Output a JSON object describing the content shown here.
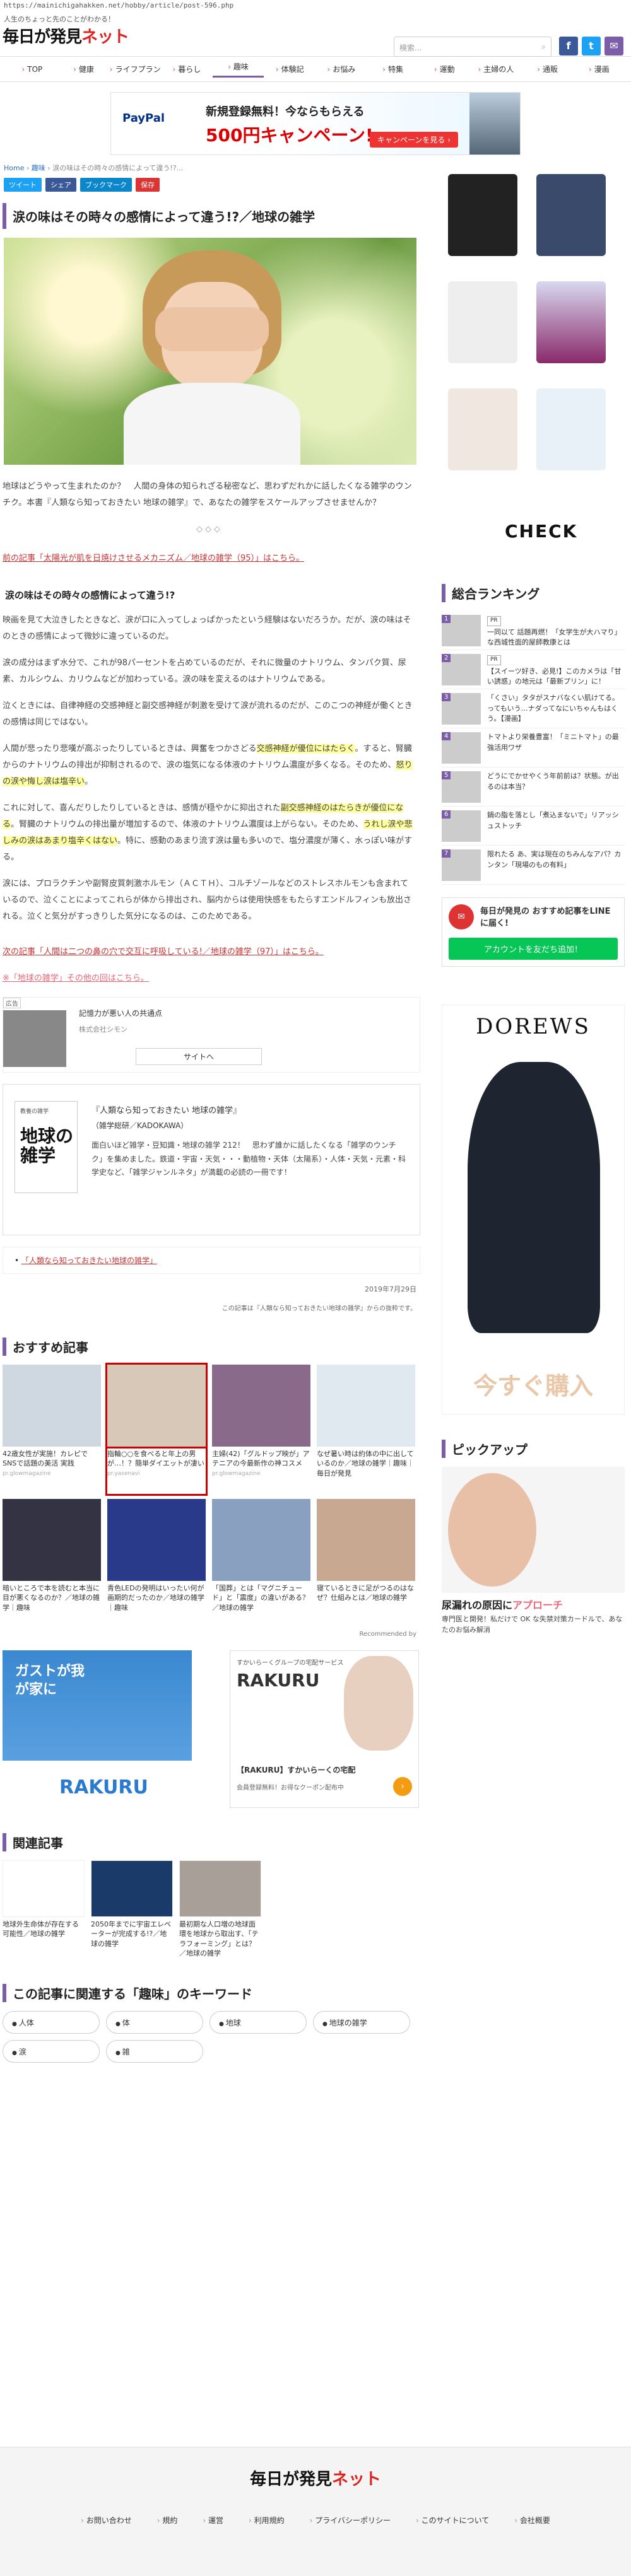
{
  "url": "https://mainichigahakken.net/hobby/article/post-596.php",
  "header": {
    "tagline": "人生のちょっと先のことがわかる！",
    "logo": "毎日が発見ネット",
    "search_placeholder": "検索...",
    "search_icon": "search-icon",
    "sns": [
      {
        "name": "facebook",
        "label": "f",
        "color": "#3b5998"
      },
      {
        "name": "twitter",
        "label": "t",
        "color": "#1da1f2"
      },
      {
        "name": "mail",
        "label": "✉",
        "color": "#7b5ea7"
      }
    ]
  },
  "nav": [
    "TOP",
    "健康",
    "ライフプラン",
    "暮らし",
    "趣味",
    "体験記",
    "お悩み",
    "特集",
    "運動",
    "主婦の人",
    "通販",
    "漫画"
  ],
  "nav_active": 4,
  "top_ad": {
    "brand": "PayPal",
    "line1": "新規登録無料！今ならもらえる",
    "line2": "500円キャンペーン!",
    "button": "キャンペーンを見る ›"
  },
  "breadcrumb": {
    "home": "Home",
    "cat": "趣味",
    "current": "涙の味はその時々の感情によって違う!?..."
  },
  "share": [
    {
      "label": "ツイート",
      "color": "#1da1f2"
    },
    {
      "label": "シェア",
      "color": "#3b5998"
    },
    {
      "label": "ブックマーク",
      "color": "#0a87cb"
    },
    {
      "label": "保存",
      "color": "#d33"
    }
  ],
  "article": {
    "title": "涙の味はその時々の感情によって違う!?／地球の雑学",
    "intro": "地球はどうやって生まれたのか？　人間の身体の知られざる秘密など、思わずだれかに話したくなる雑学のウンチク。本書『人類なら知っておきたい 地球の雑学』で、あなたの雑学をスケールアップさせませんか？",
    "dots": "◇◇◇",
    "prev_link": "前の記事「太陽光が肌を日焼けさせるメカニズム／地球の雑学（95）」はこちら。",
    "section_title": "涙の味はその時々の感情によって違う!?",
    "p1": "映画を見て大泣きしたときなど、涙が口に入ってしょっぱかったという経験はないだろうか。だが、涙の味はそのときの感情によって微妙に違っているのだ。",
    "p2": "涙の成分はまず水分で、これが98パーセントを占めているのだが、それに微量のナトリウム、タンパク質、尿素、カルシウム、カリウムなどが加わっている。涙の味を変えるのはナトリウムである。",
    "p3": "泣くときには、自律神経の交感神経と副交感神経が刺激を受けて涙が流れるのだが、このこつの神経が働くときの感情は同じではない。",
    "p4_a": "人間が悲ったり悲嘆が高ぶったりしているときは、興奮をつかさどる",
    "p4_hl1": "交感神経が優位にはたらく",
    "p4_b": "。すると、腎臓からのナトリウムの排出が抑制されるので、涙の塩気になる体液のナトリウム濃度が多くなる。そのため、",
    "p4_hl2": "怒りの涙や悔し涙は塩辛い",
    "p4_c": "。",
    "p5_a": "これに対して、喜んだりしたりしているときは、感情が穏やかに抑出された",
    "p5_hl1": "副交感神経のはたらきが優位になる",
    "p5_b": "。腎臓のナトリウムの排出量が増加するので、体液のナトリウム濃度は上がらない。そのため、",
    "p5_hl2": "うれし涙や悲しみの涙はあまり塩辛くはない",
    "p5_c": "。特に、感動のあまり流す涙は量も多いので、塩分濃度が薄く、水っぽい味がする。",
    "p6": "涙には、プロラクチンや副腎皮質刺激ホルモン（ＡＣＴＨ）、コルチゾールなどのストレスホルモンも含まれているので、泣くことによってこれらが体から排出され、脳内からは使用快感をもたらすエンドルフィンも放出される。泣くと気分がすっきりした気分になるのは、このためである。",
    "next_link": "次の記事「人間は二つの鼻の穴で交互に呼吸している!／地球の雑学（97）」はこちら。",
    "list_link": "※「地球の雑学」その他の回はこちら。"
  },
  "inline_ad": {
    "tag": "広告",
    "title": "記憶力が悪い人の共通点",
    "sponsor": "株式会社シモン",
    "button": "サイトへ"
  },
  "book": {
    "cover_small": "教養の雑学",
    "cover_title": "地球の雑学",
    "title": "『人類なら知っておきたい 地球の雑学』",
    "publisher": "（雑学総研／KADOKAWA）",
    "desc": "面白いほど雑学・豆知識・地球の雑学 212！　思わず誰かに話したくなる「雑学のウンチク」を集めました。鉄道・宇宙・天気・・・動植物・天体（太陽系）・人体・天気・元素・科学史など、「雑学ジャンルネタ」が満載の必読の一冊です！"
  },
  "link_box": "「人類なら知っておきたい地球の雑学」",
  "date": "2019年7月29日",
  "credit": "この記事は『人類なら知っておきたい地球の雑学』からの抜粋です。",
  "reco": {
    "heading": "おすすめ記事",
    "items": [
      {
        "cap": "42歳女性が実施！カレピで SNSで話題の美活 実践",
        "src": "pr.glowmagazine",
        "color": "#cfd8e0"
      },
      {
        "cap": "指輪○○を食べると年上の男が…！？簡単ダイエットが凄い",
        "src": "pr.yasenavi",
        "color": "#d8c8b8",
        "selected": true
      },
      {
        "cap": "主婦(42)「グルドップ映が」アテニアの今最新作の神コスメ",
        "src": "pr.glowmagazine",
        "color": "#8a6a8a"
      },
      {
        "cap": "なぜ暑い時は約体の中に出しているのか／地球の雑学｜趣味｜毎日が発見",
        "src": "",
        "color": "#e0e8f0"
      },
      {
        "cap": "暗いところで本を読むと本当に目が悪くなるのか？／地球の雑学｜趣味",
        "src": "",
        "color": "#334"
      },
      {
        "cap": "青色LEDの発明はいったい何が画期的だったのか／地球の雑学｜趣味",
        "src": "",
        "color": "#2a3a8a"
      },
      {
        "cap": "「国葬」とは「マグニチュード」と「震度」の違いがある？／地球の雑学",
        "src": "",
        "color": "#8aa0c0"
      },
      {
        "cap": "寝ているときに足がつるのはなぜ？仕組みとは／地球の雑学",
        "src": "",
        "color": "#c8a890"
      }
    ],
    "recommended_by": "Recommended by"
  },
  "bottom_ads": {
    "gusto": {
      "l1": "ガストが我が家に",
      "l2": "RAKURU"
    },
    "rakuru": {
      "l1": "すかいらーくグループの宅配サービス",
      "l2": "RAKURU",
      "l3": "【RAKURU】すかいらーくの宅配",
      "l4": "会員登録無料！お得なクーポン配布中"
    }
  },
  "related": {
    "heading": "関連記事",
    "items": [
      {
        "cap": "地球外生命体が存在する可能性／地球の雑学",
        "color": "#fff"
      },
      {
        "cap": "2050年までに宇宙エレベーターが完成する!?／地球の雑学",
        "color": "#1a3a6a"
      },
      {
        "cap": "最初期な人口増の地球面環を地球から取出す、「テラフォーミング」とは？／地球の雑学",
        "color": "#a8a098"
      }
    ]
  },
  "keywords": {
    "heading": "この記事に関連する「趣味」のキーワード",
    "items": [
      "人体",
      "体",
      "地球",
      "地球の雑学",
      "涙",
      "雑"
    ]
  },
  "side": {
    "ranking_heading": "総合ランキング",
    "ranking": [
      {
        "pr": true,
        "text": "一同以て 話題再燃！「女学生が大ハマり」な西城性面的屋師教康とは"
      },
      {
        "pr": true,
        "text": "【スイーツ好き、必見!】このカメラは「甘い誘惑」の地元は「最新プリン」に！"
      },
      {
        "pr": false,
        "text": "「くさい」タタがスナバなくい肌けてる。ってもいう…ナダってなにいちゃんもはくう。【漫画】"
      },
      {
        "pr": false,
        "text": "トマトより栄養豊富！「ミニトマト」の最強活用ワザ"
      },
      {
        "pr": false,
        "text": "どうにでかせやくう年前前は？状態。が出るのは本当？"
      },
      {
        "pr": false,
        "text": "鍋の脂を落とし「煮込まないで」リアッシュストッチ"
      },
      {
        "pr": false,
        "text": "限れたる あ、実は現在のちみんなアパ？カンタン「現場のもの有料」"
      }
    ],
    "line_title": "毎日が発見の おすすめ記事をLINEに届く!",
    "line_button": "アカウントを友だち追加！",
    "check_logo": "CHECK",
    "dress_brand": "DOREWS",
    "dress_cta": "今すぐ購入",
    "pickup_heading": "ピックアップ",
    "pickup_cap_a": "尿漏れの原因に",
    "pickup_cap_b": "アプローチ",
    "pickup_desc": "専門医と開発！私だけで OK な失禁対策カードルで、あなたのお悩み解消"
  },
  "footer": {
    "logo": "毎日が発見ネット",
    "links": [
      "お問い合わせ",
      "規約",
      "運営",
      "利用規約",
      "プライバシーポリシー",
      "このサイトについて",
      "会社概要"
    ]
  },
  "colors": {
    "accent": "#7b5ea7",
    "link_red": "#c33",
    "highlight": "#ffffa0",
    "line_green": "#06c755"
  }
}
